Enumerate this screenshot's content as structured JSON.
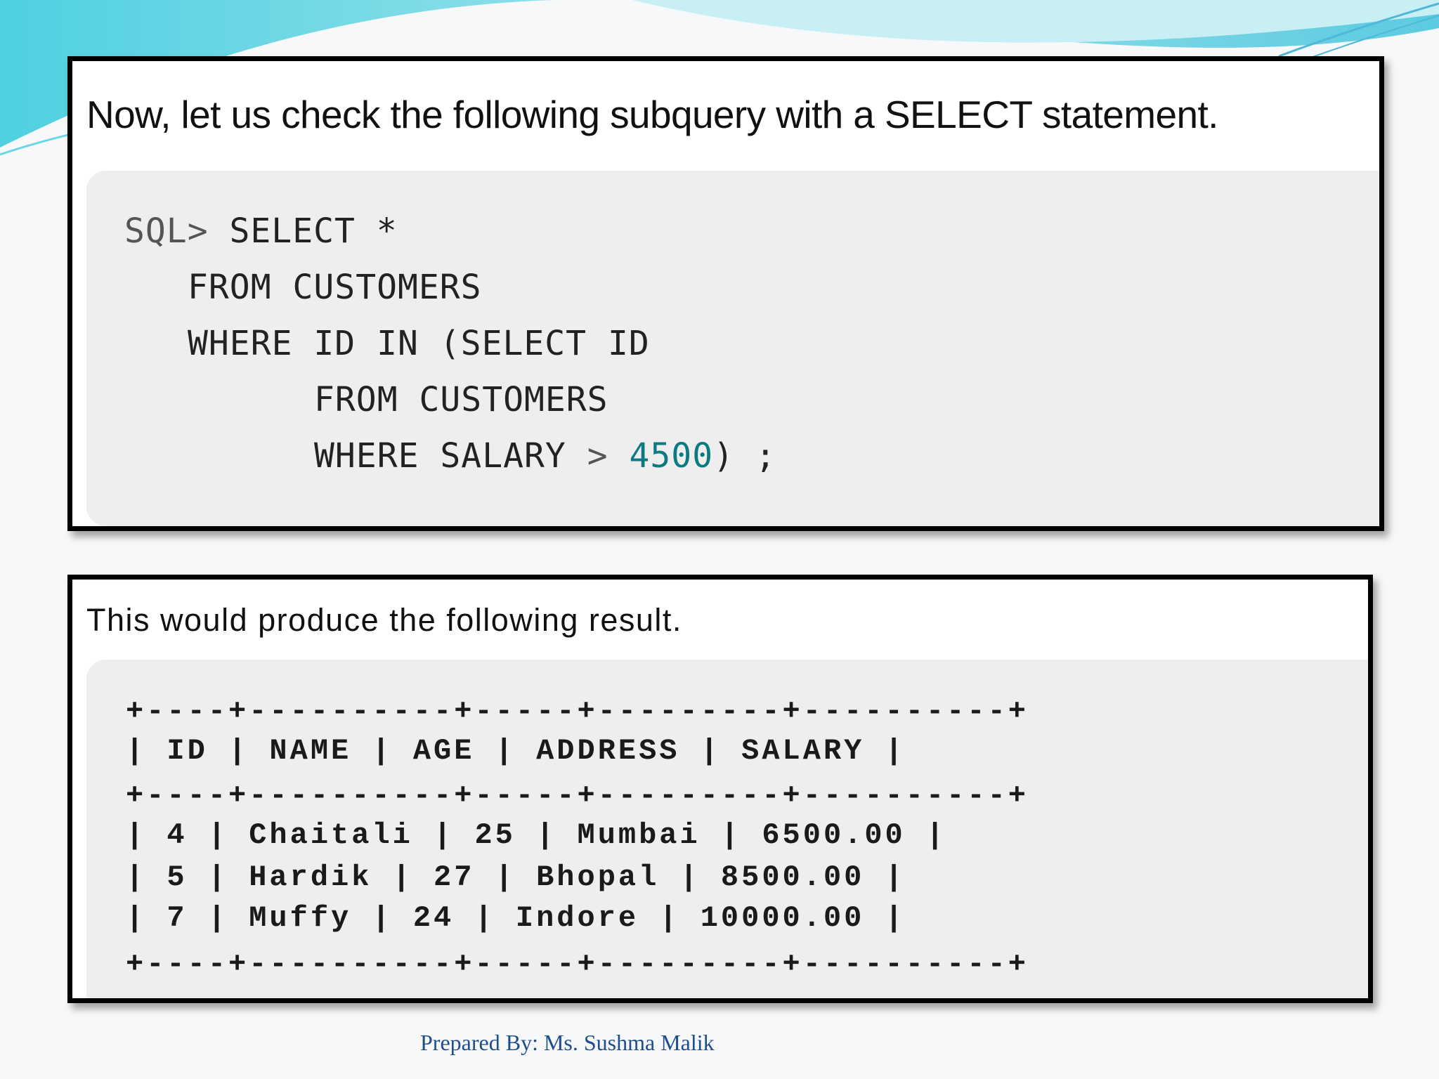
{
  "colors": {
    "panel_border": "#000000",
    "code_background": "#eeeeee",
    "number_literal": "#0b7a82",
    "footer_text": "#1f4e8c",
    "wave_accent": "#5fd3e0"
  },
  "query_panel": {
    "heading": "Now, let us check the following subquery with a SELECT statement.",
    "code": {
      "line1_prompt": "SQL> ",
      "line1_rest": "SELECT *",
      "line2": "FROM CUSTOMERS",
      "line3": "WHERE ID IN (SELECT ID",
      "line4": "FROM CUSTOMERS",
      "line5_text": "WHERE SALARY ",
      "line5_op": ">",
      "line5_value": "4500",
      "line5_end": ") ;"
    }
  },
  "result_panel": {
    "heading": "This would produce the following result.",
    "border_line": "+----+----------+-----+---------+----------+",
    "header_row": "| ID | NAME | AGE | ADDRESS | SALARY |",
    "rows": [
      "| 4 | Chaitali | 25 | Mumbai | 6500.00 |",
      "| 5 | Hardik | 27 | Bhopal | 8500.00 |",
      "| 7 | Muffy | 24 | Indore | 10000.00 |"
    ]
  },
  "footer": {
    "credit": "Prepared By: Ms. Sushma Malik"
  }
}
